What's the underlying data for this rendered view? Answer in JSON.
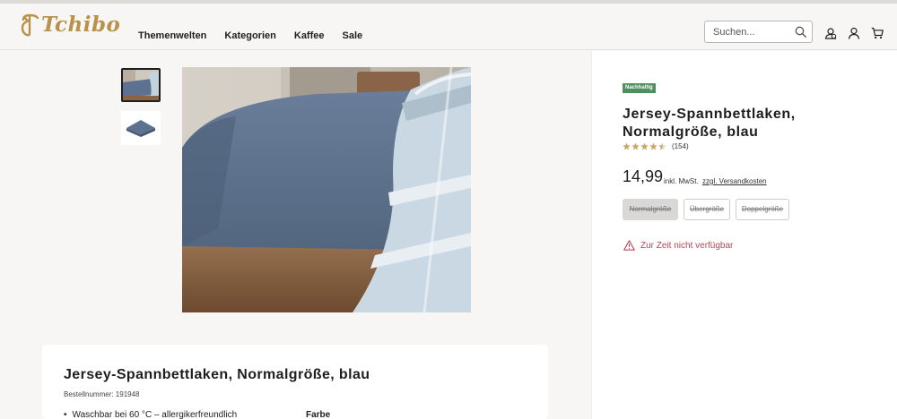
{
  "brand": {
    "name": "Tchibo",
    "color": "#b8924a"
  },
  "nav": [
    {
      "label": "Themenwelten"
    },
    {
      "label": "Kategorien"
    },
    {
      "label": "Kaffee"
    },
    {
      "label": "Sale"
    }
  ],
  "search": {
    "placeholder": "Suchen...",
    "icon": "search-icon"
  },
  "header_icons": [
    "account-switch-icon",
    "user-icon",
    "cart-icon"
  ],
  "gallery": {
    "thumbnails": [
      {
        "selected": true
      },
      {
        "selected": false
      }
    ]
  },
  "product": {
    "badge": "Nachhaltig",
    "badge_color": "#4e8f5d",
    "title": "Jersey-Spannbettlaken, Normalgröße, blau",
    "rating": 4.5,
    "rating_max": 5,
    "rating_count": "(154)",
    "price": "14,99",
    "price_note": "inkl. MwSt.",
    "shipping_link": "zzgl. Versandkosten",
    "sizes": [
      {
        "label": "Normalgröße",
        "selected": true
      },
      {
        "label": "Übergröße",
        "selected": false
      },
      {
        "label": "Doppelgröße",
        "selected": false
      }
    ],
    "availability": "Zur Zeit nicht verfügbar",
    "availability_color": "#b8455a"
  },
  "details": {
    "title": "Jersey-Spannbettlaken, Normalgröße, blau",
    "order_number": "Bestellnummer: 191948",
    "feature": "Waschbar bei 60 °C – allergikerfreundlich",
    "color_label": "Farbe"
  }
}
